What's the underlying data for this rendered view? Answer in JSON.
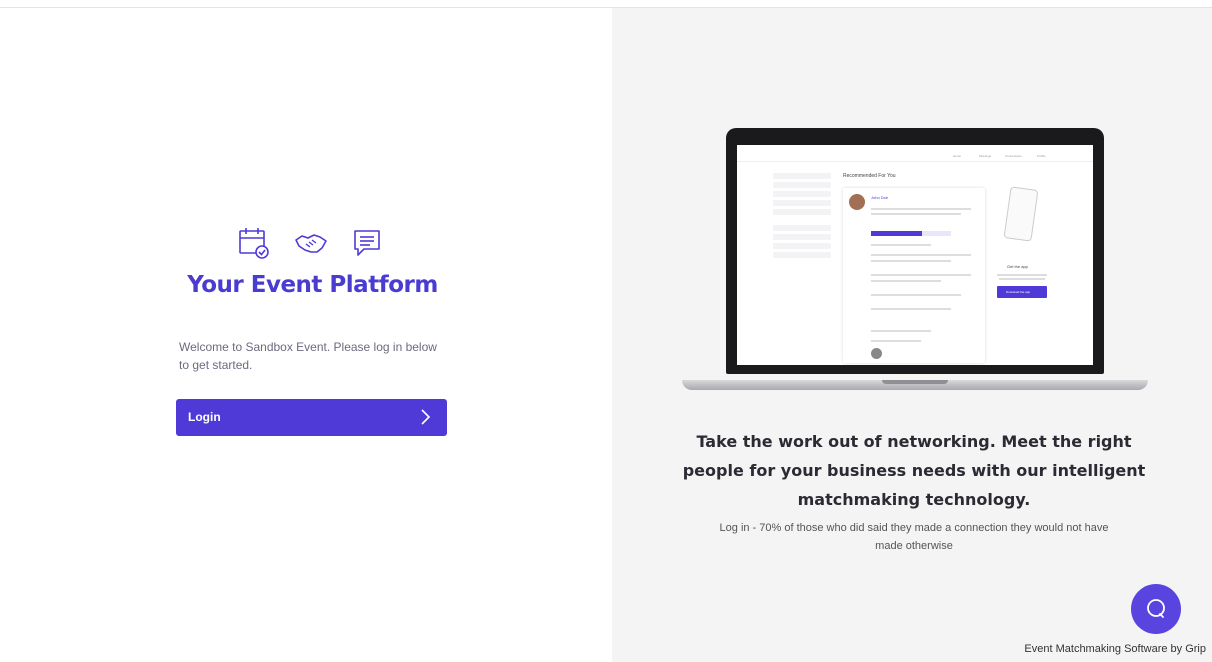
{
  "brand": {
    "title": "Your Event Platform",
    "accent_color": "#4f3ad8",
    "icons": [
      "calendar-check-icon",
      "handshake-icon",
      "chat-bubble-icon"
    ]
  },
  "login": {
    "welcome_text": "Welcome to Sandbox Event. Please log in below to get started.",
    "button_label": "Login"
  },
  "promo": {
    "tagline": "Take the work out of networking. Meet the right people for your business needs with our intelligent matchmaking technology.",
    "subtext": "Log in - 70% of those who did said they made a connection they would not have made otherwise"
  },
  "mockup": {
    "nav": [
      "Home",
      "Meetings",
      "Connections",
      "Profile"
    ],
    "heading": "Recommended For You",
    "person_name": "John Doe",
    "app_title": "Get the app",
    "download_label": "Download the app"
  },
  "support": {
    "icon": "chat-support-icon"
  },
  "footer": {
    "text": "Event Matchmaking Software by Grip"
  }
}
